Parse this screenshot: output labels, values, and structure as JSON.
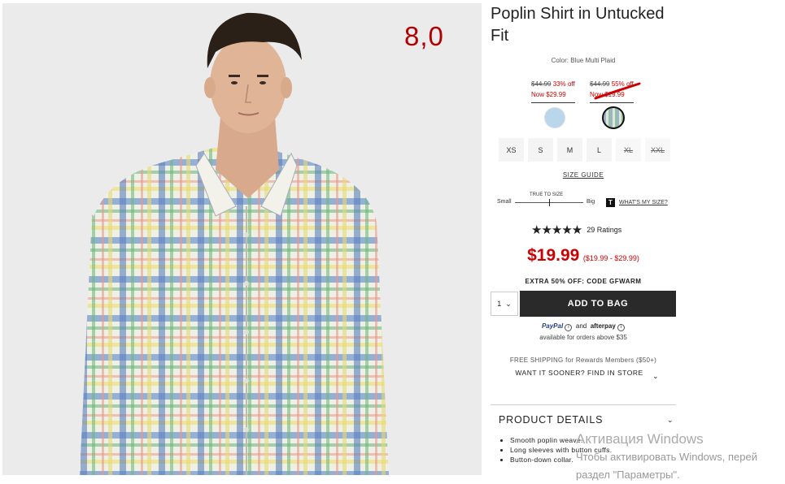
{
  "overlay": {
    "score": "8,0"
  },
  "product": {
    "title_line1": "Poplin Shirt in Untucked",
    "title_line2": "Fit",
    "color_label": "Color: Blue Multi Plaid"
  },
  "swatches": [
    {
      "old_price": "$44.99",
      "discount": "33% off",
      "now_price": "Now $29.99",
      "color": "#b9d6ea"
    },
    {
      "old_price": "$44.99",
      "discount": "55% off",
      "now_price": "Now $19.99",
      "color": "#9db4c6"
    }
  ],
  "sizes": [
    {
      "label": "XS",
      "available": true
    },
    {
      "label": "S",
      "available": true
    },
    {
      "label": "M",
      "available": true
    },
    {
      "label": "L",
      "available": true
    },
    {
      "label": "XL",
      "available": false
    },
    {
      "label": "XXL",
      "available": false
    }
  ],
  "size_guide": "SIZE GUIDE",
  "fit_scale": {
    "left": "Small",
    "center": "TRUE TO SIZE",
    "right": "Big",
    "badge": "T",
    "whats_my_size": "WHAT'S MY SIZE?"
  },
  "rating": {
    "stars": "★★★★★",
    "count_text": "29 Ratings"
  },
  "price": {
    "main": "$19.99",
    "range": "($19.99 - $29.99)"
  },
  "promo": "EXTRA 50% OFF: CODE GFWARM",
  "quantity": {
    "value": "1",
    "chevron": "⌄"
  },
  "add_to_bag": "ADD TO BAG",
  "payment": {
    "paypal": "PayPal",
    "and": "and",
    "afterpay": "afterpay",
    "info": "i",
    "availability": "available for orders above $35"
  },
  "shipping": "FREE SHIPPING for Rewards Members ($50+)",
  "find_in_store": "WANT IT SOONER? FIND IN STORE",
  "product_details": {
    "heading": "PRODUCT DETAILS",
    "items": [
      "Smooth poplin weave.",
      "Long sleeves with button cuffs.",
      "Button-down collar."
    ]
  },
  "windows_watermark": {
    "line1": "Активация Windows",
    "line2": "Чтобы активировать Windows, перей",
    "line3": "раздел \"Параметры\"."
  },
  "colors": {
    "sale_red": "#cc0000",
    "button_dark": "#2a2a2a",
    "score_red": "#b00000"
  }
}
